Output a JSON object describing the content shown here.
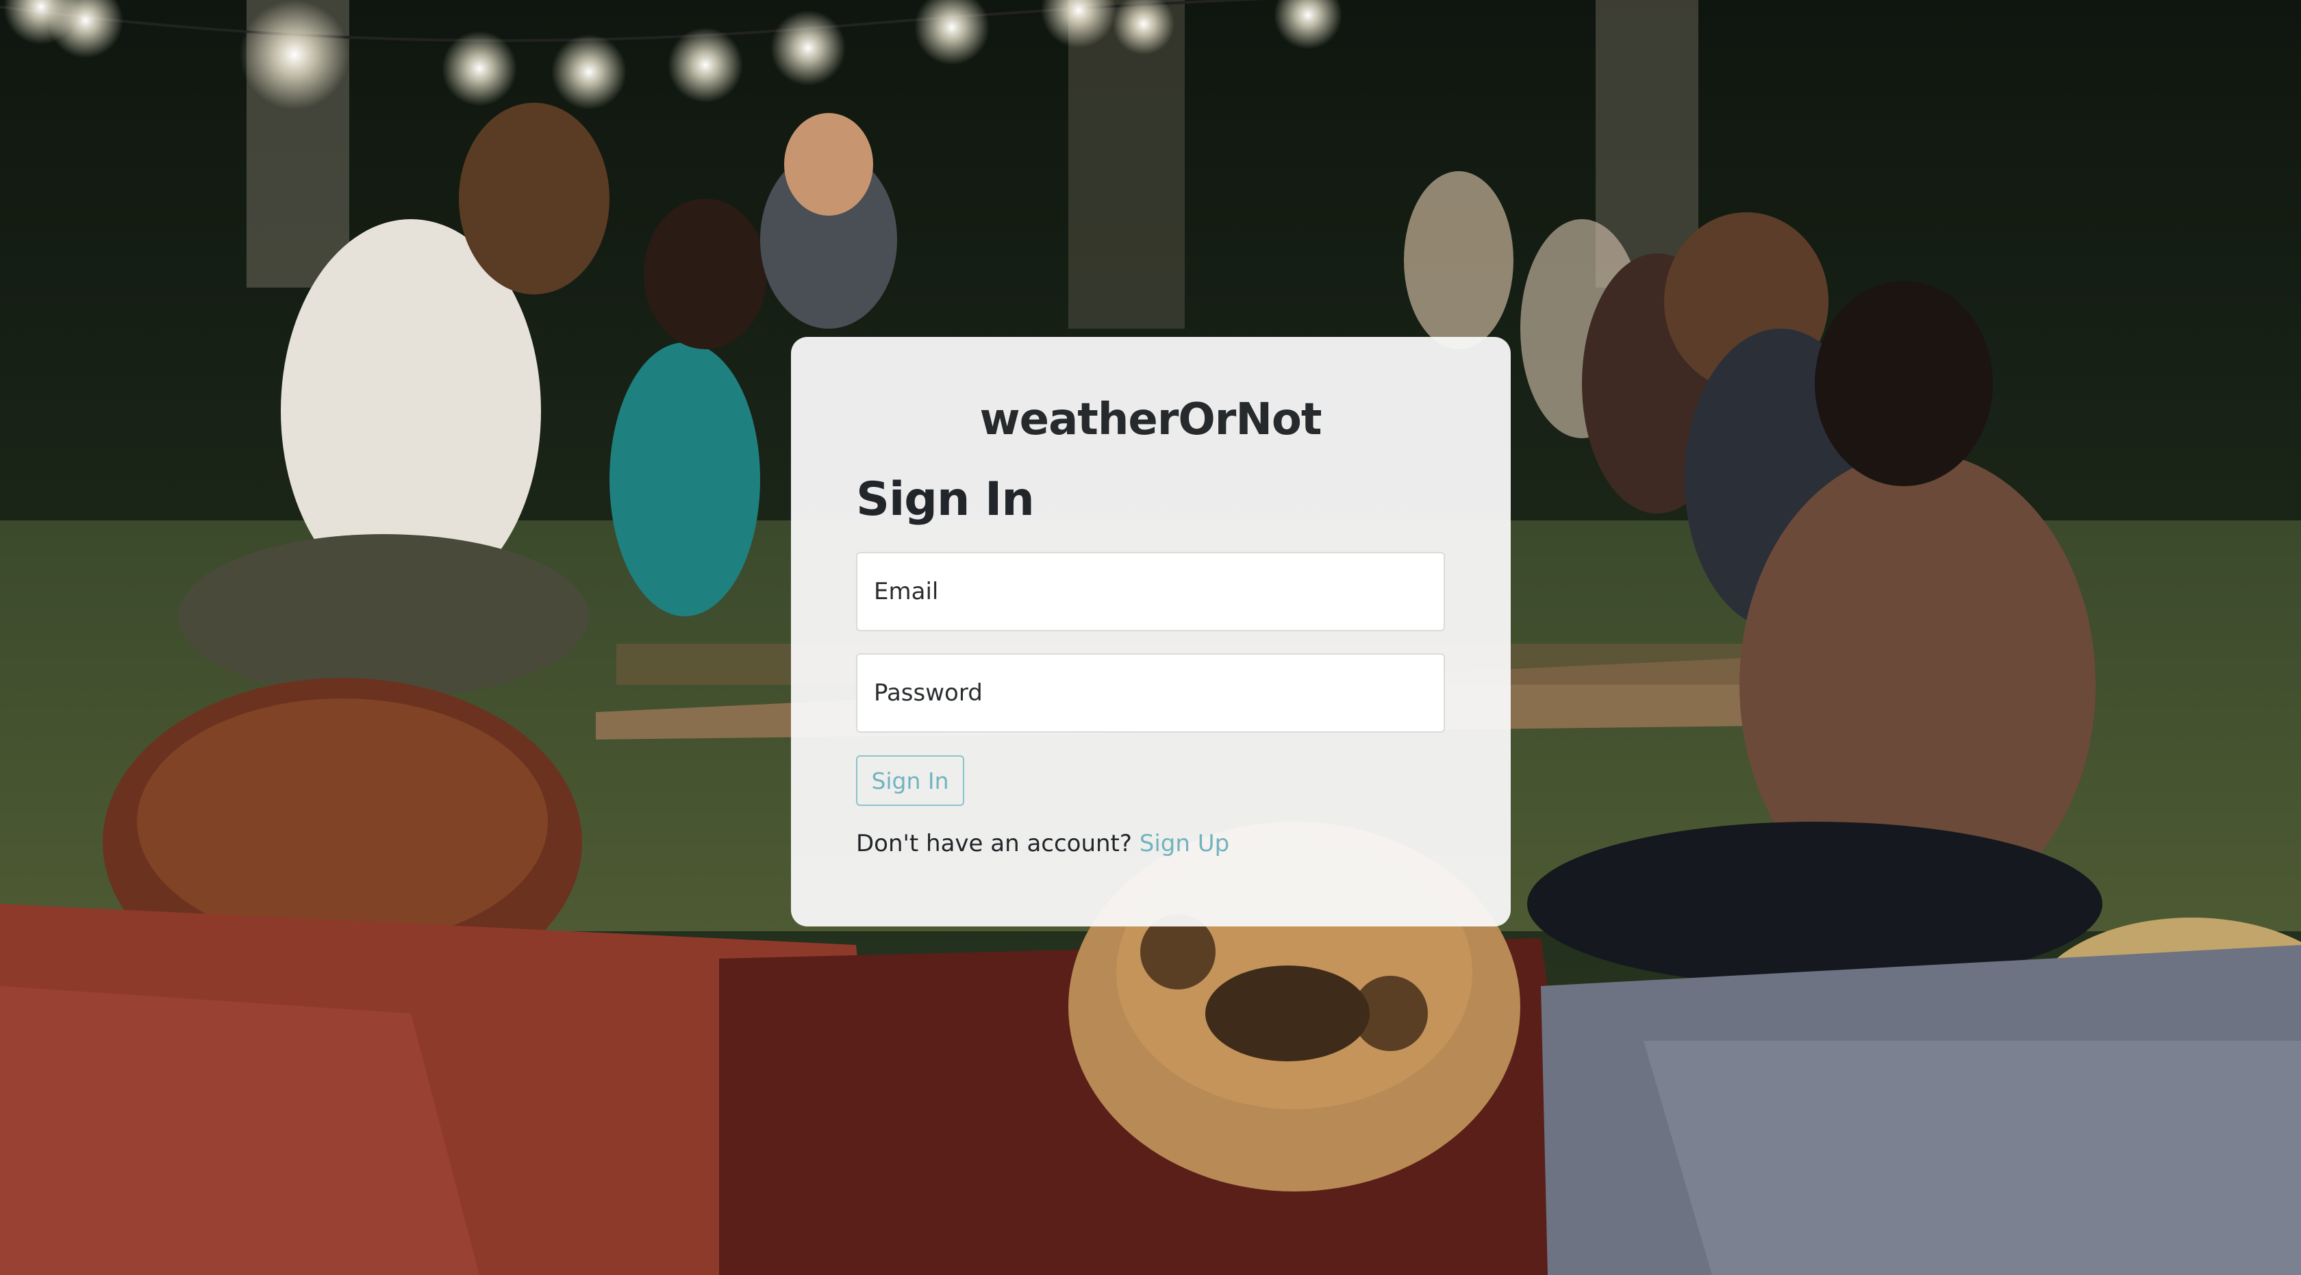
{
  "app": {
    "brand": "weatherOrNot"
  },
  "form": {
    "heading": "Sign In",
    "email_placeholder": "Email",
    "password_placeholder": "Password",
    "submit_label": "Sign In",
    "account_prompt": "Don't have an account?",
    "signup_link": "Sign Up"
  },
  "colors": {
    "accent": "#72b3bf",
    "text": "#22262a",
    "card_background": "#f8f8f8"
  }
}
